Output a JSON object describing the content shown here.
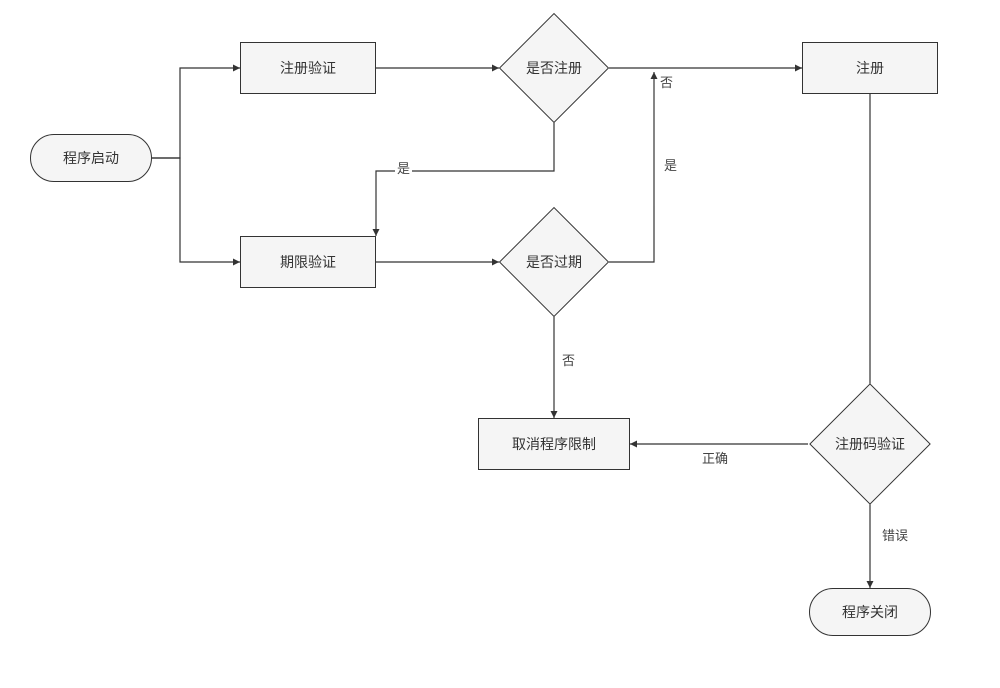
{
  "chart_data": {
    "type": "flowchart",
    "nodes": [
      {
        "id": "start",
        "kind": "terminator",
        "label": "程序启动"
      },
      {
        "id": "reg_verify",
        "kind": "process",
        "label": "注册验证"
      },
      {
        "id": "is_registered",
        "kind": "decision",
        "label": "是否注册"
      },
      {
        "id": "register",
        "kind": "process",
        "label": "注册"
      },
      {
        "id": "term_verify",
        "kind": "process",
        "label": "期限验证"
      },
      {
        "id": "is_expired",
        "kind": "decision",
        "label": "是否过期"
      },
      {
        "id": "unlock",
        "kind": "process",
        "label": "取消程序限制"
      },
      {
        "id": "code_verify",
        "kind": "decision",
        "label": "注册码验证"
      },
      {
        "id": "end",
        "kind": "terminator",
        "label": "程序关闭"
      }
    ],
    "edges": [
      {
        "from": "start",
        "to": "reg_verify",
        "label": ""
      },
      {
        "from": "start",
        "to": "term_verify",
        "label": ""
      },
      {
        "from": "reg_verify",
        "to": "is_registered",
        "label": ""
      },
      {
        "from": "is_registered",
        "to": "register",
        "label": "否"
      },
      {
        "from": "is_registered",
        "to": "term_verify",
        "label": "是"
      },
      {
        "from": "term_verify",
        "to": "is_expired",
        "label": ""
      },
      {
        "from": "is_expired",
        "to": "register",
        "label": "是"
      },
      {
        "from": "is_expired",
        "to": "unlock",
        "label": "否"
      },
      {
        "from": "register",
        "to": "code_verify",
        "label": ""
      },
      {
        "from": "code_verify",
        "to": "unlock",
        "label": "正确"
      },
      {
        "from": "code_verify",
        "to": "end",
        "label": "错误"
      }
    ]
  },
  "nodes": {
    "start": {
      "label": "程序启动"
    },
    "reg_verify": {
      "label": "注册验证"
    },
    "is_registered": {
      "label": "是否注册"
    },
    "register": {
      "label": "注册"
    },
    "term_verify": {
      "label": "期限验证"
    },
    "is_expired": {
      "label": "是否过期"
    },
    "unlock": {
      "label": "取消程序限制"
    },
    "code_verify": {
      "label": "注册码验证"
    },
    "end": {
      "label": "程序关闭"
    }
  },
  "edge_labels": {
    "is_registered_no": "否",
    "is_registered_yes": "是",
    "is_expired_yes": "是",
    "is_expired_no": "否",
    "code_correct": "正确",
    "code_wrong": "错误"
  }
}
